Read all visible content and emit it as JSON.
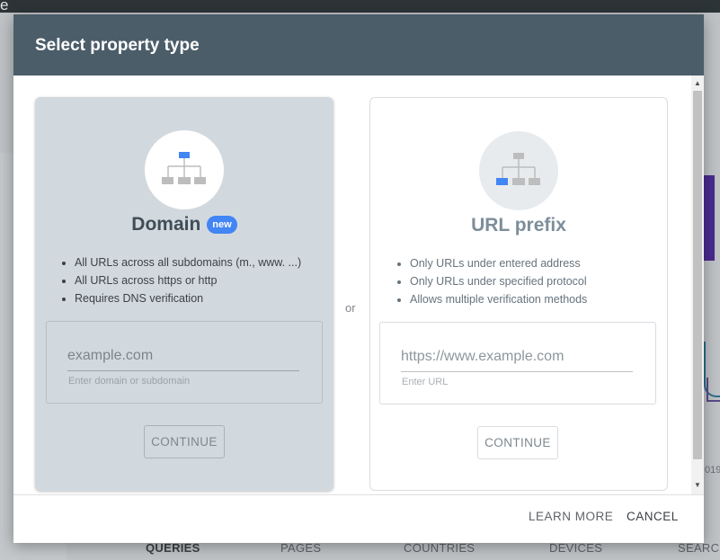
{
  "background": {
    "app_title_fragment": "e",
    "chart_year_fragment": "019",
    "tabs": [
      {
        "label": "QUERIES",
        "active": true
      },
      {
        "label": "PAGES",
        "active": false
      },
      {
        "label": "COUNTRIES",
        "active": false
      },
      {
        "label": "DEVICES",
        "active": false
      },
      {
        "label": "SEARCH",
        "active": false
      }
    ]
  },
  "modal": {
    "title": "Select property type",
    "separator": "or",
    "domain": {
      "title": "Domain",
      "badge": "new",
      "icon": "sitemap-top-highlight-icon",
      "bullets": [
        "All URLs across all subdomains (m., www. ...)",
        "All URLs across https or http",
        "Requires DNS verification"
      ],
      "input_placeholder": "example.com",
      "input_value": "",
      "input_hint": "Enter domain or subdomain",
      "button_label": "CONTINUE"
    },
    "url_prefix": {
      "title": "URL prefix",
      "icon": "sitemap-leaf-highlight-icon",
      "bullets": [
        "Only URLs under entered address",
        "Only URLs under specified protocol",
        "Allows multiple verification methods"
      ],
      "input_placeholder": "https://www.example.com",
      "input_value": "",
      "input_hint": "Enter URL",
      "button_label": "CONTINUE"
    },
    "footer": {
      "learn_more": "LEARN MORE",
      "cancel": "CANCEL"
    }
  },
  "colors": {
    "header_bg": "#4b5d69",
    "accent_blue": "#4285f4",
    "domain_card_bg": "#d2d9de"
  }
}
